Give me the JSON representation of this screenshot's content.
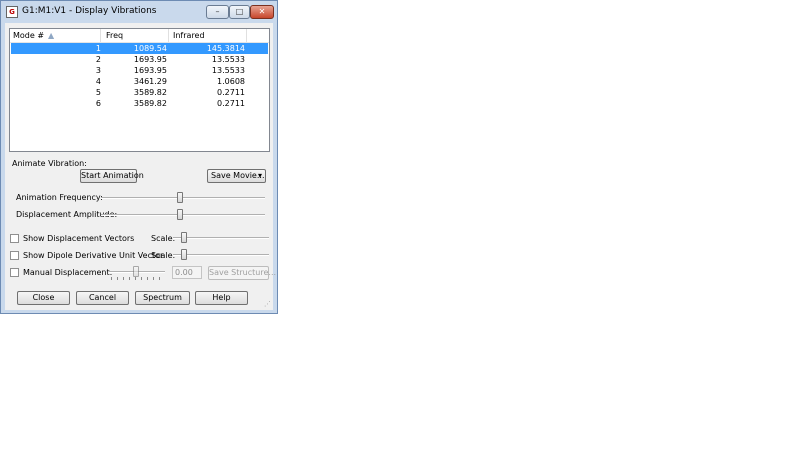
{
  "window": {
    "title": "G1:M1:V1 - Display Vibrations",
    "icon": "app-icon",
    "controls": {
      "minimize": "–",
      "maximize": "□",
      "close": "✕"
    }
  },
  "table": {
    "headers": {
      "mode": "Mode #",
      "sort_indicator": "▲",
      "freq": "Freq",
      "ir": "Infrared"
    },
    "rows": [
      {
        "mode": "1",
        "freq": "1089.54",
        "ir": "145.3814"
      },
      {
        "mode": "2",
        "freq": "1693.95",
        "ir": "13.5533"
      },
      {
        "mode": "3",
        "freq": "1693.95",
        "ir": "13.5533"
      },
      {
        "mode": "4",
        "freq": "3461.29",
        "ir": "1.0608"
      },
      {
        "mode": "5",
        "freq": "3589.82",
        "ir": "0.2711"
      },
      {
        "mode": "6",
        "freq": "3589.82",
        "ir": "0.2711"
      }
    ],
    "selected_row": 1
  },
  "animate": {
    "section_label": "Animate Vibration:",
    "start_button": "Start Animation",
    "save_movie_button": "Save Movie...",
    "dropdown_arrow": "▾",
    "frequency_label": "Animation Frequency:",
    "amplitude_label": "Displacement Amplitude:"
  },
  "options": {
    "displacement_vectors_label": "Show Displacement Vectors",
    "dipole_label": "Show Dipole Derivative Unit Vector",
    "manual_label": "Manual Displacement:",
    "scale_label": "Scale:",
    "manual_value": "0.00",
    "save_structure_button": "Save Structure..."
  },
  "buttons": {
    "close": "Close",
    "cancel": "Cancel",
    "spectrum": "Spectrum",
    "help": "Help"
  },
  "colors": {
    "selection": "#3399ff",
    "window_frame": "#c9d9ec",
    "client": "#f0f0f0"
  }
}
